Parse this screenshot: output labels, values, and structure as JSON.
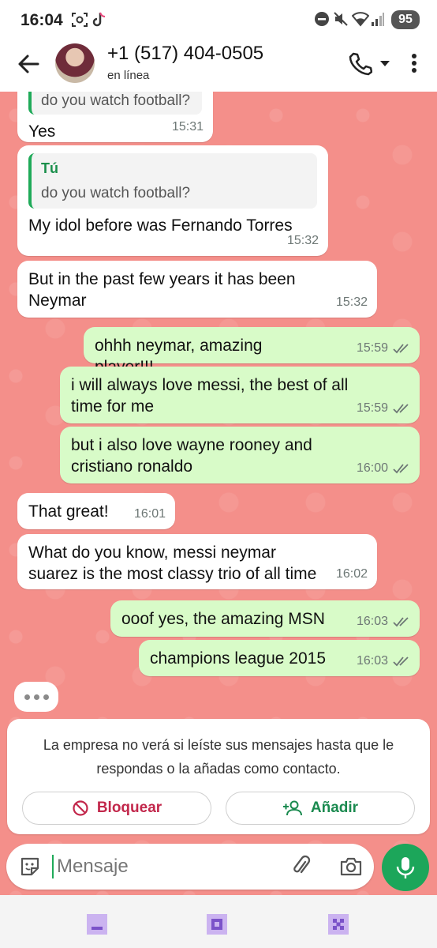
{
  "status_bar": {
    "time": "16:04",
    "battery": "95",
    "icons": [
      "screenshot-icon",
      "tiktok-icon",
      "do-not-disturb-icon",
      "mute-icon",
      "wifi-icon",
      "signal-icon"
    ]
  },
  "header": {
    "contact_name": "+1 (517) 404-0505",
    "contact_status": "en línea",
    "icons": [
      "back-arrow-icon",
      "phone-icon",
      "caret-down-icon",
      "more-vert-icon"
    ]
  },
  "messages": [
    {
      "direction": "in",
      "partial_quote_text": "do you watch football?",
      "text": "Yes",
      "time": "15:31"
    },
    {
      "direction": "in",
      "quote_author": "Tú",
      "quote_text": "do you watch football?",
      "text": "My idol before was Fernando Torres",
      "time": "15:32"
    },
    {
      "direction": "in",
      "text": "But in the past few years it has been Neymar",
      "time": "15:32"
    },
    {
      "direction": "out",
      "text": "ohhh neymar, amazing player!!!",
      "time": "15:59",
      "read": true
    },
    {
      "direction": "out",
      "text": "i will always love messi, the best of all time for me",
      "time": "15:59",
      "read": true
    },
    {
      "direction": "out",
      "text": "but i also love wayne rooney and cristiano ronaldo",
      "time": "16:00",
      "read": true
    },
    {
      "direction": "in",
      "text": "That great!",
      "time": "16:01"
    },
    {
      "direction": "in",
      "text": "What do you know, messi neymar suarez is the most classy trio of all time",
      "time": "16:02"
    },
    {
      "direction": "out",
      "text": "ooof yes, the amazing MSN",
      "time": "16:03",
      "read": true
    },
    {
      "direction": "out",
      "text": "champions league 2015",
      "time": "16:03",
      "read": true
    }
  ],
  "notice": {
    "text": "La empresa no verá si leíste sus mensajes hasta que le respondas o la añadas como contacto.",
    "block_label": "Bloquear",
    "add_label": "Añadir"
  },
  "input": {
    "placeholder": "Mensaje"
  },
  "colors": {
    "chat_background": "#f48f8a",
    "outgoing_bubble": "#d8fbc8",
    "incoming_bubble": "#ffffff",
    "accent_green": "#1ca65a",
    "block_red": "#c2274b"
  }
}
